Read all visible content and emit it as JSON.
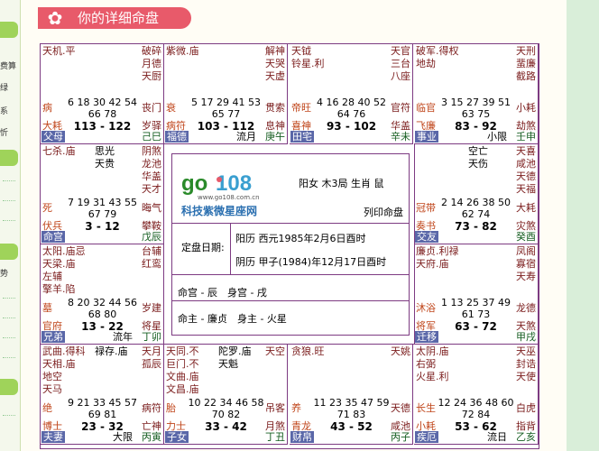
{
  "sidebar": {
    "items": [
      "费算",
      "绿",
      "系",
      "忻",
      "势"
    ]
  },
  "header": {
    "title": "你的详细命盘"
  },
  "center": {
    "site_url": "www.go108.com.cn",
    "site_name": "科技紫微星座网",
    "gender_info": "阳女 木3局 生肖 鼠",
    "print_label": "列印命盘",
    "date_label": "定盘日期:",
    "solar_date": "阳历 西元1985年2月6日酉时",
    "lunar_date": "阴历 甲子(1984)年12月17日酉时",
    "ming_shen": "命宫 - 辰　身宫 - 戌",
    "zhu": "命主 - 廉贞　身主 - 火星"
  },
  "cells": [
    {
      "main": "天机.平",
      "side": "破碎\n月德\n天厨",
      "mid": "",
      "nums": "6 18 30 42 54\n66 78",
      "range": "113 - 122",
      "lt1": "病",
      "lt2": "大耗",
      "rt1": "丧门",
      "rt2": "岁驿",
      "palace": "父母",
      "limit": "",
      "ganzhi": "己巳"
    },
    {
      "main": "紫微.庙",
      "side": "解神\n天哭\n天虚",
      "mid": "",
      "nums": "5 17 29 41 53\n65 77",
      "range": "103 - 112",
      "lt1": "衰",
      "lt2": "病符",
      "rt1": "贯索",
      "rt2": "息神",
      "palace": "福德",
      "limit": "流月",
      "ganzhi": "庚午"
    },
    {
      "main": "天钺\n铃星.利",
      "side": "天官\n三台\n八座",
      "mid": "",
      "nums": "4 16 28 40 52\n64 76",
      "range": "93 - 102",
      "lt1": "帝旺",
      "lt2": "喜神",
      "rt1": "官符",
      "rt2": "华盖",
      "palace": "田宅",
      "limit": "",
      "ganzhi": "辛未"
    },
    {
      "main": "破军.得权\n地劫",
      "side": "天刑\n蜚廉\n截路",
      "mid": "",
      "nums": "3 15 27 39 51\n63 75",
      "range": "83 - 92",
      "lt1": "临官",
      "lt2": "飞廉",
      "rt1": "小耗",
      "rt2": "劫煞",
      "palace": "事业",
      "limit": "小限",
      "ganzhi": "壬申"
    },
    {
      "main": "七杀.庙",
      "side": "阴煞\n龙池\n华盖\n天才",
      "mid": "思光\n天贵",
      "nums": "7 19 31 43 55\n67 79",
      "range": "3 - 12",
      "lt1": "死",
      "lt2": "伏兵",
      "rt1": "晦气",
      "rt2": "攀鞍",
      "palace": "命宫",
      "limit": "",
      "ganzhi": "戊辰"
    },
    {
      "main": "",
      "side": "天喜\n咸池\n天德\n天福",
      "mid": "空亡\n天伤",
      "nums": "2 14 26 38 50\n62 74",
      "range": "73 - 82",
      "lt1": "冠带",
      "lt2": "奏书",
      "rt1": "大耗",
      "rt2": "灾煞",
      "palace": "交友",
      "limit": "",
      "ganzhi": "癸酉"
    },
    {
      "main": "太阳.庙忌\n天梁.庙\n左辅\n擎羊.陷",
      "side": "台辅\n红鸾",
      "mid": "",
      "nums": "8 20 32 44 56\n68 80",
      "range": "13 - 22",
      "lt1": "墓",
      "lt2": "官府",
      "rt1": "岁建",
      "rt2": "将星",
      "palace": "兄弟",
      "limit": "流年",
      "ganzhi": "丁卯"
    },
    {
      "main": "廉贞.利禄\n天府.庙",
      "side": "凤阁\n寡宿\n天寿",
      "mid": "",
      "nums": "1 13 25 37 49\n61 73",
      "range": "63 - 72",
      "lt1": "沐浴",
      "lt2": "将军",
      "rt1": "龙德",
      "rt2": "天煞",
      "palace": "迁移",
      "limit": "",
      "ganzhi": "甲戌"
    },
    {
      "main": "武曲.得科\n天相.庙\n地空\n天马",
      "side": "天月\n孤辰",
      "mid": "禄存.庙",
      "nums": "9 21 33 45 57\n69 81",
      "range": "23 - 32",
      "lt1": "绝",
      "lt2": "博士",
      "rt1": "病符",
      "rt2": "亡神",
      "palace": "夫妻",
      "limit": "大限",
      "ganzhi": "丙寅"
    },
    {
      "main": "天同.不\n巨门.不\n文曲.庙\n文昌.庙",
      "side": "天空",
      "mid": "陀罗.庙\n天魁",
      "nums": "10 22 34 46 58\n70 82",
      "range": "33 - 42",
      "lt1": "胎",
      "lt2": "力士",
      "rt1": "吊客",
      "rt2": "月煞",
      "palace": "子女",
      "limit": "",
      "ganzhi": "丁丑"
    },
    {
      "main": "贪狼.旺",
      "side": "天姚",
      "mid": "",
      "nums": "11 23 35 47 59\n71 83",
      "range": "43 - 52",
      "lt1": "养",
      "lt2": "青龙",
      "rt1": "天德",
      "rt2": "咸池",
      "palace": "财帛",
      "limit": "",
      "ganzhi": "丙子"
    },
    {
      "main": "太阴.庙\n右弼\n火星.利",
      "side": "天巫\n封诰\n天使",
      "mid": "",
      "nums": "12 24 36 48 60\n72 84",
      "range": "53 - 62",
      "lt1": "长生",
      "lt2": "小耗",
      "rt1": "白虎",
      "rt2": "指背",
      "palace": "疾厄",
      "limit": "流日",
      "ganzhi": "乙亥"
    }
  ]
}
